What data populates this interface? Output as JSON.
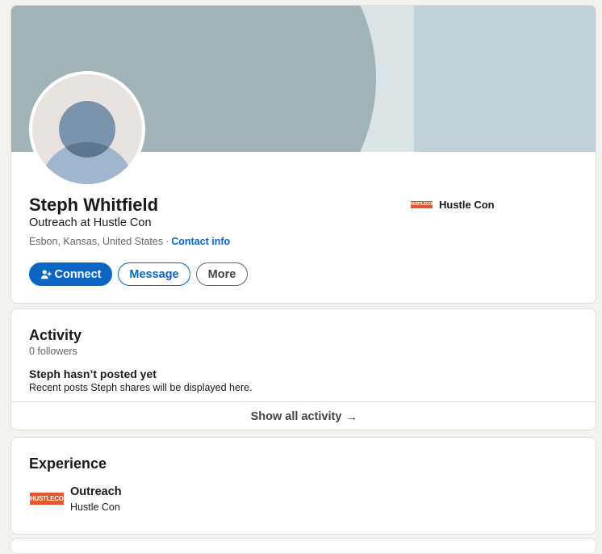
{
  "profile": {
    "name": "Steph Whitfield",
    "headline": "Outreach at Hustle Con",
    "location": "Esbon, Kansas, United States",
    "separator": "·",
    "contact_info_label": "Contact info",
    "current_company": {
      "name": "Hustle Con",
      "logo_text": "HUSTLECON"
    },
    "actions": {
      "connect_label": "Connect",
      "message_label": "Message",
      "more_label": "More"
    }
  },
  "activity": {
    "title": "Activity",
    "followers": "0 followers",
    "empty_title": "Steph hasn’t posted yet",
    "empty_subtitle": "Recent posts Steph shares will be displayed here.",
    "show_all_label": "Show all activity",
    "show_all_icon": "arrow-right-icon"
  },
  "experience": {
    "title": "Experience",
    "items": [
      {
        "role": "Outreach",
        "company": "Hustle Con",
        "logo_text": "HUSTLECON"
      }
    ]
  },
  "colors": {
    "primary": "#0a66c2",
    "logo": "#e2572b",
    "background": "#f4f2ee"
  }
}
